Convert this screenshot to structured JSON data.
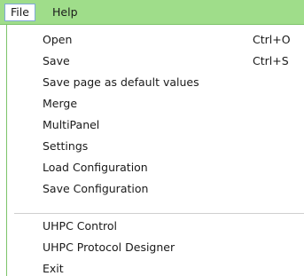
{
  "menubar": {
    "file_label": "File",
    "help_label": "Help"
  },
  "file_menu": {
    "items": [
      {
        "label": "Open",
        "shortcut": "Ctrl+O"
      },
      {
        "label": "Save",
        "shortcut": "Ctrl+S"
      },
      {
        "label": "Save page as default values",
        "shortcut": ""
      },
      {
        "label": "Merge",
        "shortcut": ""
      },
      {
        "label": "MultiPanel",
        "shortcut": ""
      },
      {
        "label": "Settings",
        "shortcut": ""
      },
      {
        "label": "Load Configuration",
        "shortcut": ""
      },
      {
        "label": "Save Configuration",
        "shortcut": ""
      },
      {
        "label": "UHPC Control",
        "shortcut": ""
      },
      {
        "label": "UHPC Protocol Designer",
        "shortcut": ""
      },
      {
        "label": "Exit",
        "shortcut": ""
      }
    ]
  },
  "colors": {
    "menubar_background": "#9fdd8a",
    "menu_background": "#ffffff",
    "active_item_border": "#7fa8d6"
  }
}
